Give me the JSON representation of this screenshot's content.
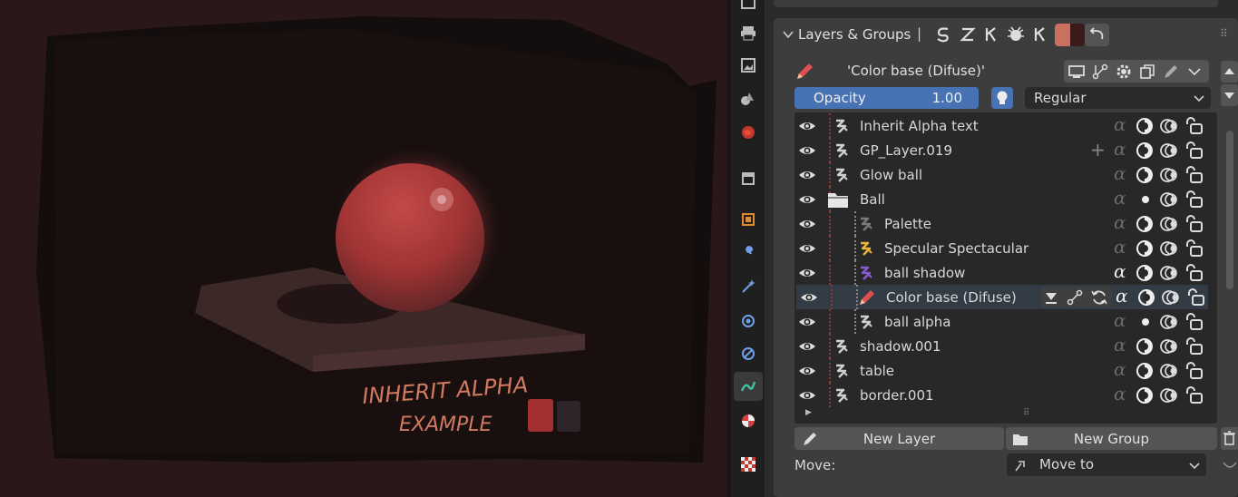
{
  "viewport": {
    "artwork_text_line1": "INHERIT ALPHA",
    "artwork_text_line2": "EXAMPLE"
  },
  "panel": {
    "section_title": "Layers & Groups",
    "active_layer_name": "'Color base (Difuse)'",
    "opacity_label": "Opacity",
    "opacity_value": "1.00",
    "blend_mode": "Regular",
    "layers": [
      {
        "name": "Inherit Alpha text",
        "indent": 0,
        "kind": "layer",
        "icon_color": "#d0d0d0",
        "alpha": "dim",
        "mask": "full"
      },
      {
        "name": "GP_Layer.019",
        "indent": 0,
        "kind": "layer",
        "icon_color": "#d0d0d0",
        "alpha": "dim",
        "mask": "full",
        "hover_plus": true
      },
      {
        "name": "Glow ball",
        "indent": 0,
        "kind": "layer",
        "icon_color": "#d0d0d0",
        "alpha": "dim",
        "mask": "full"
      },
      {
        "name": "Ball",
        "indent": 0,
        "kind": "group",
        "icon_color": "#e6e6e6",
        "alpha": "dim",
        "mask": "dot"
      },
      {
        "name": "Palette",
        "indent": 1,
        "kind": "layer",
        "icon_color": "#7a7a7a",
        "alpha": "dim",
        "mask": "full"
      },
      {
        "name": "Specular Spectacular",
        "indent": 1,
        "kind": "layer",
        "icon_color": "#e8b33a",
        "alpha": "dim",
        "mask": "full"
      },
      {
        "name": "ball shadow",
        "indent": 1,
        "kind": "layer",
        "icon_color": "#8a5ad1",
        "alpha": "bright",
        "mask": "full"
      },
      {
        "name": "Color base (Difuse)",
        "indent": 1,
        "kind": "active",
        "icon_color": "#e05050",
        "alpha": "bright",
        "mask": "full"
      },
      {
        "name": "ball alpha",
        "indent": 1,
        "kind": "layer",
        "icon_color": "#d0d0d0",
        "alpha": "dim",
        "mask": "dot"
      },
      {
        "name": "shadow.001",
        "indent": 0,
        "kind": "layer",
        "icon_color": "#d0d0d0",
        "alpha": "dim",
        "mask": "full"
      },
      {
        "name": "table",
        "indent": 0,
        "kind": "layer",
        "icon_color": "#d0d0d0",
        "alpha": "dim",
        "mask": "full"
      },
      {
        "name": "border.001",
        "indent": 0,
        "kind": "layer",
        "icon_color": "#d0d0d0",
        "alpha": "dim",
        "mask": "full"
      }
    ],
    "new_layer_label": "New Layer",
    "new_group_label": "New Group",
    "move_label": "Move:",
    "move_value": "Move to",
    "colors": {
      "accent_blue": "#4772b3",
      "swatch_left": "#c97060",
      "swatch_right": "#3a1a1a"
    }
  }
}
